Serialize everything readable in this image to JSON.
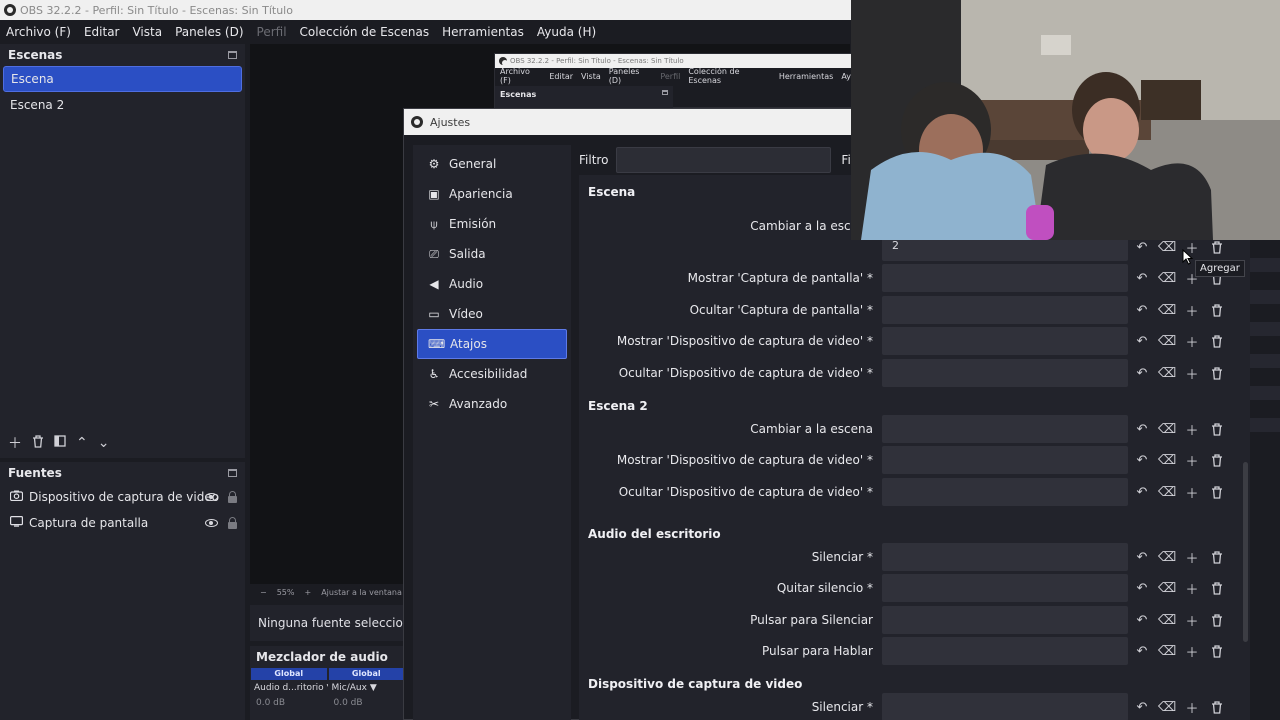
{
  "window": {
    "title": "OBS 32.2.2 - Perfil: Sin Título - Escenas: Sin Título"
  },
  "menu": {
    "items": [
      "Archivo (F)",
      "Editar",
      "Vista",
      "Paneles (D)",
      "Perfil",
      "Colección de Escenas",
      "Herramientas",
      "Ayuda (H)"
    ]
  },
  "scenes_dock": {
    "title": "Escenas",
    "items": [
      "Escena",
      "Escena 2"
    ],
    "selected": "Escena"
  },
  "sources_dock": {
    "title": "Fuentes",
    "items": [
      "Dispositivo de captura de video",
      "Captura de pantalla"
    ]
  },
  "preview": {
    "zoom": "55%",
    "fit_label": "Ajustar a la ventana",
    "no_source": "Ninguna fuente seleccionada"
  },
  "inner_obs": {
    "title": "OBS 32.2.2 - Perfil: Sin Título - Escenas: Sin Título",
    "menu": [
      "Archivo (F)",
      "Editar",
      "Vista",
      "Paneles (D)",
      "Perfil",
      "Colección de Escenas",
      "Herramientas",
      "Ay"
    ],
    "dock_title": "Escenas"
  },
  "mixer": {
    "title": "Mezclador de audio",
    "channels": [
      {
        "global": "Global",
        "name": "Audio d...ritorio",
        "db": "0.0 dB"
      },
      {
        "global": "Global",
        "name": "Mic/Aux",
        "db": "0.0 dB"
      }
    ]
  },
  "settings": {
    "title": "Ajustes",
    "nav": [
      {
        "label": "General",
        "icon": "gear-icon",
        "glyph": "⚙"
      },
      {
        "label": "Apariencia",
        "icon": "appearance-icon",
        "glyph": "▣"
      },
      {
        "label": "Emisión",
        "icon": "broadcast-icon",
        "glyph": "⍦"
      },
      {
        "label": "Salida",
        "icon": "output-icon",
        "glyph": "⎚"
      },
      {
        "label": "Audio",
        "icon": "speaker-icon",
        "glyph": "◀"
      },
      {
        "label": "Vídeo",
        "icon": "monitor-icon",
        "glyph": "▭"
      },
      {
        "label": "Atajos",
        "icon": "keyboard-icon",
        "glyph": "⌨"
      },
      {
        "label": "Accesibilidad",
        "icon": "accessibility-icon",
        "glyph": "♿"
      },
      {
        "label": "Avanzado",
        "icon": "tools-icon",
        "glyph": "✂"
      }
    ],
    "active_nav": "Atajos",
    "filter_label": "Filtro",
    "filter_label2": "Filtr",
    "sections": {
      "escena": "Escena",
      "escena2": "Escena 2",
      "audio": "Audio del escritorio",
      "dispositivo": "Dispositivo de captura de video"
    },
    "hotkeys": {
      "switch1": "Cambiar a la escena",
      "key_value": "2",
      "show_screen": "Mostrar 'Captura de pantalla' *",
      "hide_screen": "Ocultar 'Captura de pantalla' *",
      "show_device": "Mostrar 'Dispositivo de captura de video' *",
      "hide_device": "Ocultar 'Dispositivo de captura de video' *",
      "switch2": "Cambiar a la escena",
      "show_device2": "Mostrar 'Dispositivo de captura de video' *",
      "hide_device2": "Ocultar 'Dispositivo de captura de video' *",
      "mute": "Silenciar *",
      "unmute": "Quitar silencio *",
      "ptm": "Pulsar para Silenciar",
      "ptt": "Pulsar para Hablar",
      "mute2": "Silenciar *"
    },
    "tooltip": "Agregar"
  },
  "colors": {
    "accent": "#2b4fc4",
    "panel": "#22232b",
    "background": "#1b1c22"
  }
}
